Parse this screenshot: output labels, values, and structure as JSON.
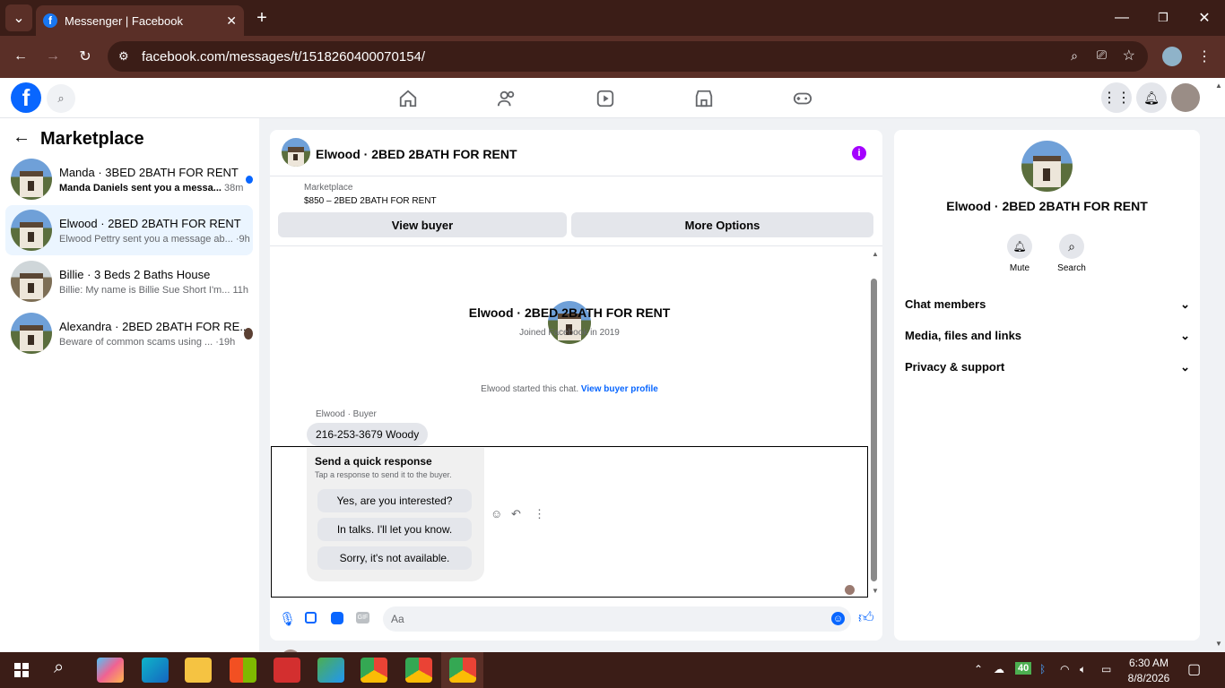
{
  "browser": {
    "tab_title": "Messenger | Facebook",
    "url": "facebook.com/messages/t/1518260400070154/"
  },
  "left": {
    "header": "Marketplace",
    "conversations": [
      {
        "name": "Manda · 3BED 2BATH FOR RENT",
        "preview": "Manda Daniels sent you a messa...",
        "time": "38m",
        "unread": true
      },
      {
        "name": "Elwood · 2BED 2BATH FOR RENT",
        "preview": "Elwood Pettry sent you a message ab...",
        "time": "·9h"
      },
      {
        "name": "Billie · 3 Beds 2 Baths House",
        "preview": "Billie: My name is Billie Sue Short I'm...",
        "time": "11h"
      },
      {
        "name": "Alexandra · 2BED 2BATH FOR RE...",
        "preview": "Beware of common scams using ...",
        "time": "·19h"
      }
    ]
  },
  "chat": {
    "title": "Elwood · 2BED 2BATH FOR RENT",
    "marketplace_label": "Marketplace",
    "listing": "$850 – 2BED 2BATH FOR RENT",
    "view_buyer": "View buyer",
    "more_options": "More Options",
    "profile_name": "Elwood · 2BED 2BATH FOR RENT",
    "joined": "Joined Facebook in 2019",
    "started_text": "Elwood started this chat.",
    "view_buyer_profile": "View buyer profile",
    "sender_label": "Elwood · Buyer",
    "message": "216-253-3679 Woody",
    "quick_title": "Send a quick response",
    "quick_sub": "Tap a response to send it to the buyer.",
    "quick_responses": [
      "Yes, are you interested?",
      "In talks. I'll let you know.",
      "Sorry, it's not available."
    ],
    "input_placeholder": "Aa"
  },
  "right": {
    "name": "Elwood · 2BED 2BATH FOR RENT",
    "mute": "Mute",
    "search": "Search",
    "sections": [
      "Chat members",
      "Media, files and links",
      "Privacy & support"
    ]
  },
  "taskbar": {
    "time": "6:30 AM",
    "date": "8/8/2026",
    "temp": "40"
  },
  "colors": {
    "accent": "#0866ff",
    "purple": "#a400ff"
  }
}
